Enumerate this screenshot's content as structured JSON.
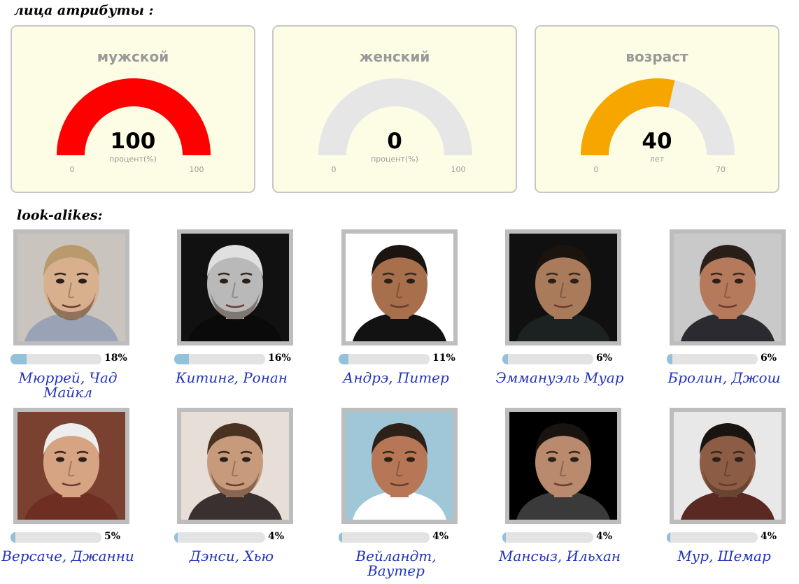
{
  "sections": {
    "attributes_title": "лица атрибуты :",
    "lookalikes_title": "look-alikes:"
  },
  "gauges": [
    {
      "title": "мужской",
      "value": "100",
      "fraction": 1.0,
      "unit": "процент(%)",
      "min": "0",
      "max": "100",
      "color": "#ff0000"
    },
    {
      "title": "женский",
      "value": "0",
      "fraction": 0.0,
      "unit": "процент(%)",
      "min": "0",
      "max": "100",
      "color": "#ff0000"
    },
    {
      "title": "возраст",
      "value": "40",
      "fraction": 0.5714,
      "unit": "лет",
      "min": "0",
      "max": "70",
      "color": "#f7a600"
    }
  ],
  "gauge_track_color": "#e6e6e6",
  "lookalikes": [
    {
      "name": "Мюррей, Чад Майкл",
      "percent": "18%",
      "fraction": 0.18
    },
    {
      "name": "Китинг, Ронан",
      "percent": "16%",
      "fraction": 0.16
    },
    {
      "name": "Андрэ, Питер",
      "percent": "11%",
      "fraction": 0.11
    },
    {
      "name": "Эммануэль Муар",
      "percent": "6%",
      "fraction": 0.06
    },
    {
      "name": "Бролин, Джош",
      "percent": "6%",
      "fraction": 0.06
    },
    {
      "name": "Версаче, Джанни",
      "percent": "5%",
      "fraction": 0.05
    },
    {
      "name": "Дэнси, Хью",
      "percent": "4%",
      "fraction": 0.04
    },
    {
      "name": "Вейландт, Ваутер",
      "percent": "4%",
      "fraction": 0.04
    },
    {
      "name": "Мансыз, Ильхан",
      "percent": "4%",
      "fraction": 0.04
    },
    {
      "name": "Мур, Шемар",
      "percent": "4%",
      "fraction": 0.04
    }
  ],
  "colors": {
    "name_link": "#2233bb",
    "bar_fill": "#92c1db",
    "bar_track": "#e3e3e3",
    "panel_bg": "#fdfde6"
  }
}
